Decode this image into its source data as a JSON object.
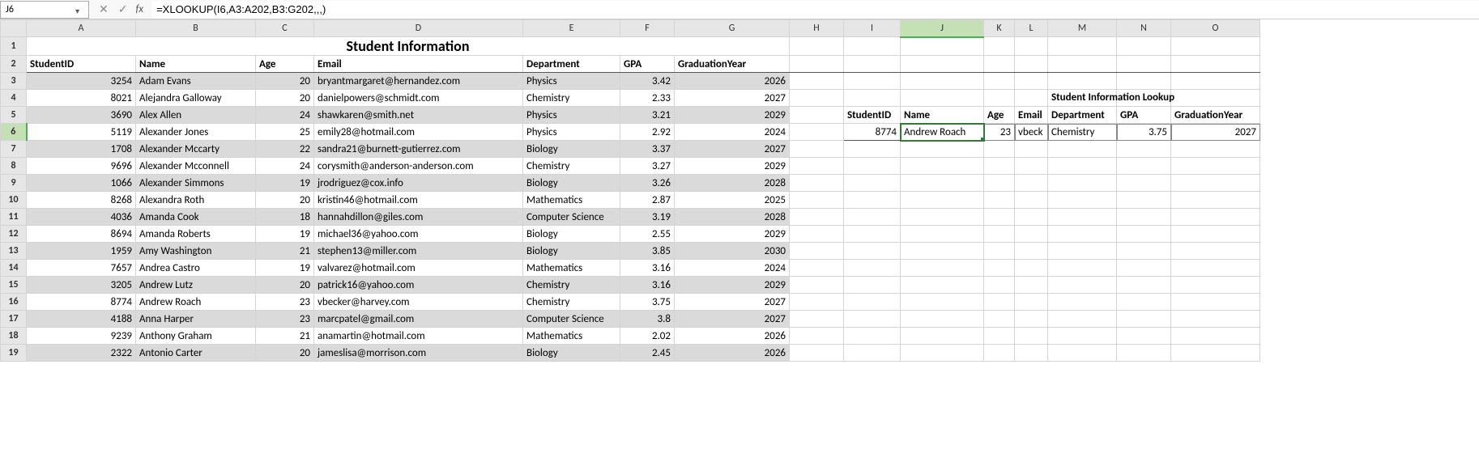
{
  "nameBox": "J6",
  "formula": "=XLOOKUP(I6,A3:A202,B3:G202,,,)",
  "columns": [
    "A",
    "B",
    "C",
    "D",
    "E",
    "F",
    "G",
    "H",
    "I",
    "J",
    "K",
    "L",
    "M",
    "N",
    "O"
  ],
  "activeCol": "J",
  "activeRow": "6",
  "titleRow": {
    "text": "Student Information"
  },
  "headers": [
    "StudentID",
    "Name",
    "Age",
    "Email",
    "Department",
    "GPA",
    "GraduationYear"
  ],
  "rows": [
    {
      "id": "3254",
      "name": "Adam Evans",
      "age": "20",
      "email": "bryantmargaret@hernandez.com",
      "dept": "Physics",
      "gpa": "3.42",
      "year": "2026"
    },
    {
      "id": "8021",
      "name": "Alejandra Galloway",
      "age": "20",
      "email": "danielpowers@schmidt.com",
      "dept": "Chemistry",
      "gpa": "2.33",
      "year": "2027"
    },
    {
      "id": "3690",
      "name": "Alex Allen",
      "age": "24",
      "email": "shawkaren@smith.net",
      "dept": "Physics",
      "gpa": "3.21",
      "year": "2029"
    },
    {
      "id": "5119",
      "name": "Alexander Jones",
      "age": "25",
      "email": "emily28@hotmail.com",
      "dept": "Physics",
      "gpa": "2.92",
      "year": "2024"
    },
    {
      "id": "1708",
      "name": "Alexander Mccarty",
      "age": "22",
      "email": "sandra21@burnett-gutierrez.com",
      "dept": "Biology",
      "gpa": "3.37",
      "year": "2027"
    },
    {
      "id": "9696",
      "name": "Alexander Mcconnell",
      "age": "24",
      "email": "corysmith@anderson-anderson.com",
      "dept": "Chemistry",
      "gpa": "3.27",
      "year": "2029"
    },
    {
      "id": "1066",
      "name": "Alexander Simmons",
      "age": "19",
      "email": "jrodriguez@cox.info",
      "dept": "Biology",
      "gpa": "3.26",
      "year": "2028"
    },
    {
      "id": "8268",
      "name": "Alexandra Roth",
      "age": "20",
      "email": "kristin46@hotmail.com",
      "dept": "Mathematics",
      "gpa": "2.87",
      "year": "2025"
    },
    {
      "id": "4036",
      "name": "Amanda Cook",
      "age": "18",
      "email": "hannahdillon@giles.com",
      "dept": "Computer Science",
      "gpa": "3.19",
      "year": "2028"
    },
    {
      "id": "8694",
      "name": "Amanda Roberts",
      "age": "19",
      "email": "michael36@yahoo.com",
      "dept": "Biology",
      "gpa": "2.55",
      "year": "2029"
    },
    {
      "id": "1959",
      "name": "Amy Washington",
      "age": "21",
      "email": "stephen13@miller.com",
      "dept": "Biology",
      "gpa": "3.85",
      "year": "2030"
    },
    {
      "id": "7657",
      "name": "Andrea Castro",
      "age": "19",
      "email": "valvarez@hotmail.com",
      "dept": "Mathematics",
      "gpa": "3.16",
      "year": "2024"
    },
    {
      "id": "3205",
      "name": "Andrew Lutz",
      "age": "20",
      "email": "patrick16@yahoo.com",
      "dept": "Chemistry",
      "gpa": "3.16",
      "year": "2029"
    },
    {
      "id": "8774",
      "name": "Andrew Roach",
      "age": "23",
      "email": "vbecker@harvey.com",
      "dept": "Chemistry",
      "gpa": "3.75",
      "year": "2027"
    },
    {
      "id": "4188",
      "name": "Anna Harper",
      "age": "23",
      "email": "marcpatel@gmail.com",
      "dept": "Computer Science",
      "gpa": "3.8",
      "year": "2027"
    },
    {
      "id": "9239",
      "name": "Anthony Graham",
      "age": "21",
      "email": "anamartin@hotmail.com",
      "dept": "Mathematics",
      "gpa": "2.02",
      "year": "2026"
    },
    {
      "id": "2322",
      "name": "Antonio Carter",
      "age": "20",
      "email": "jameslisa@morrison.com",
      "dept": "Biology",
      "gpa": "2.45",
      "year": "2026"
    }
  ],
  "lookup": {
    "title": "Student Information Lookup",
    "headers": [
      "StudentID",
      "Name",
      "Age",
      "Email",
      "Department",
      "GPA",
      "GraduationYear"
    ],
    "data": {
      "id": "8774",
      "name": "Andrew Roach",
      "age": "23",
      "email": "vbeck",
      "dept": "Chemistry",
      "gpa": "3.75",
      "year": "2027"
    }
  }
}
